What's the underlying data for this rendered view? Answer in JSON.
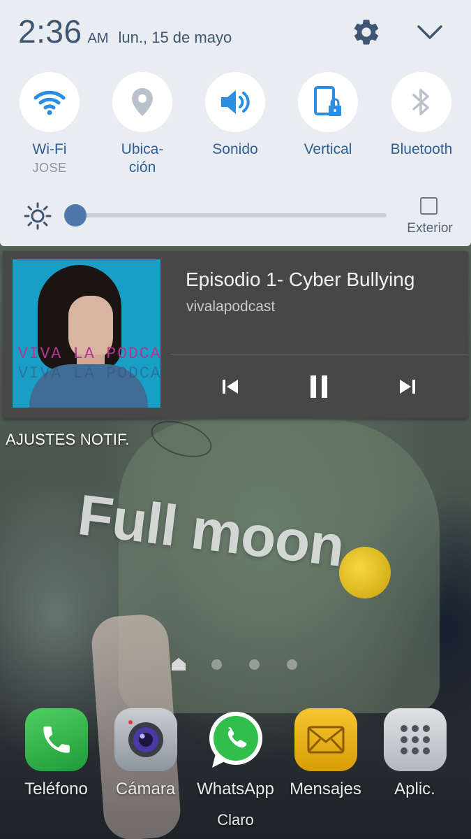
{
  "status_bar": {
    "time": "2:36",
    "ampm": "AM",
    "date": "lun., 15 de mayo"
  },
  "quick_toggles": [
    {
      "label": "Wi-Fi",
      "sublabel": "JOSE",
      "icon": "wifi-icon",
      "active": true
    },
    {
      "label": "Ubica-\nción",
      "icon": "location-icon",
      "active": false
    },
    {
      "label": "Sonido",
      "icon": "speaker-icon",
      "active": true
    },
    {
      "label": "Vertical",
      "icon": "screen-rotation-lock-icon",
      "active": true
    },
    {
      "label": "Bluetooth",
      "icon": "bluetooth-icon",
      "active": false
    }
  ],
  "brightness": {
    "level": 0.0,
    "outdoor_label": "Exterior",
    "outdoor_checked": false
  },
  "media_notification": {
    "title": "Episodio 1- Cyber Bullying",
    "artist": "vivalapodcast",
    "album_art_text": "VIVA LA PODCAST",
    "playing": true,
    "controls": [
      "previous-icon",
      "pause-icon",
      "next-icon"
    ]
  },
  "notification_settings_label": "AJUSTES NOTIF.",
  "wallpaper_text": "Full moon",
  "home_pages": {
    "count": 4,
    "current": 0
  },
  "dock_apps": [
    {
      "label": "Teléfono",
      "icon": "phone-icon",
      "color": "#2db34a"
    },
    {
      "label": "Cámara",
      "icon": "camera-icon",
      "color": "#9aa3ad"
    },
    {
      "label": "WhatsApp",
      "icon": "whatsapp-icon",
      "color": "#2fbf4a"
    },
    {
      "label": "Mensajes",
      "icon": "message-icon",
      "color": "#e9b50e"
    },
    {
      "label": "Aplic.",
      "icon": "apps-grid-icon",
      "color": "#c6c8cb"
    }
  ],
  "carrier": "Claro",
  "colors": {
    "panel_bg": "#e9edf1",
    "accent": "#2f5f96",
    "media_bg": "#474747"
  }
}
